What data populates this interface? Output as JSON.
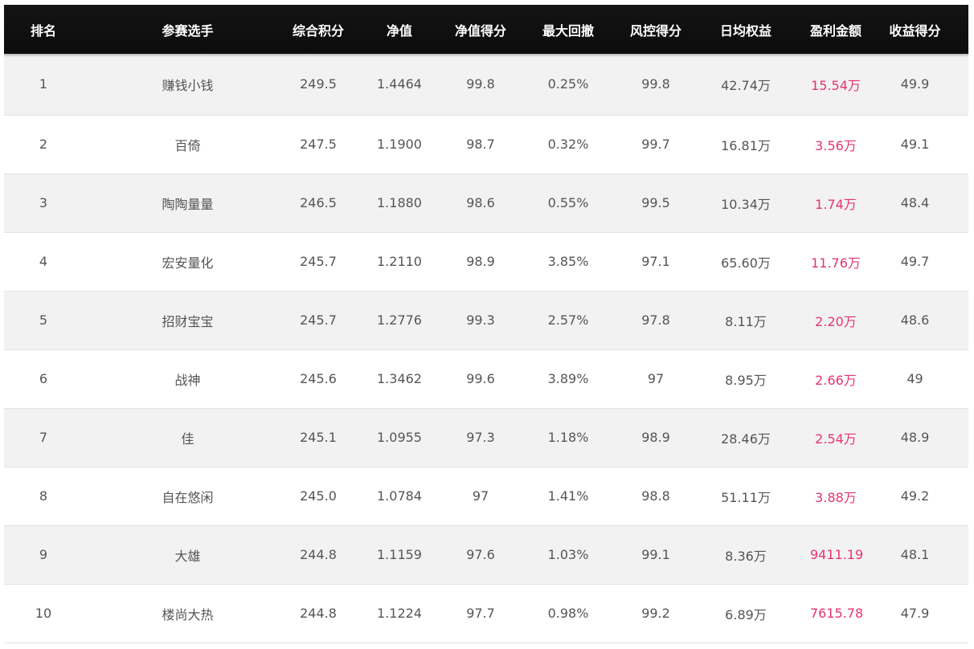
{
  "table": {
    "headers": [
      "排名",
      "参赛选手",
      "综合积分",
      "净值",
      "净值得分",
      "最大回撤",
      "风控得分",
      "日均权益",
      "盈利金额",
      "收益得分"
    ],
    "rows": [
      [
        "1",
        "赚钱小钱",
        "249.5",
        "1.4464",
        "99.8",
        "0.25%",
        "99.8",
        "42.74万",
        "15.54万",
        "49.9"
      ],
      [
        "2",
        "百倚",
        "247.5",
        "1.1900",
        "98.7",
        "0.32%",
        "99.7",
        "16.81万",
        "3.56万",
        "49.1"
      ],
      [
        "3",
        "陶陶量量",
        "246.5",
        "1.1880",
        "98.6",
        "0.55%",
        "99.5",
        "10.34万",
        "1.74万",
        "48.4"
      ],
      [
        "4",
        "宏安量化",
        "245.7",
        "1.2110",
        "98.9",
        "3.85%",
        "97.1",
        "65.60万",
        "11.76万",
        "49.7"
      ],
      [
        "5",
        "招财宝宝",
        "245.7",
        "1.2776",
        "99.3",
        "2.57%",
        "97.8",
        "8.11万",
        "2.20万",
        "48.6"
      ],
      [
        "6",
        "战神",
        "245.6",
        "1.3462",
        "99.6",
        "3.89%",
        "97",
        "8.95万",
        "2.66万",
        "49"
      ],
      [
        "7",
        "佳",
        "245.1",
        "1.0955",
        "97.3",
        "1.18%",
        "98.9",
        "28.46万",
        "2.54万",
        "48.9"
      ],
      [
        "8",
        "自在悠闲",
        "245.0",
        "1.0784",
        "97",
        "1.41%",
        "98.8",
        "51.11万",
        "3.88万",
        "49.2"
      ],
      [
        "9",
        "大雄",
        "244.8",
        "1.1159",
        "97.6",
        "1.03%",
        "99.1",
        "8.36万",
        "9411.19",
        "48.1"
      ],
      [
        "10",
        "楼尚大热",
        "244.8",
        "1.1224",
        "97.7",
        "0.98%",
        "99.2",
        "6.89万",
        "7615.78",
        "47.9"
      ]
    ]
  },
  "colors": {
    "header_bg": "#111111",
    "header_text": "#ffffff",
    "row_alt_bg": "#f2f2f2",
    "cell_text": "#555555",
    "profit_text": "#e8336e"
  }
}
